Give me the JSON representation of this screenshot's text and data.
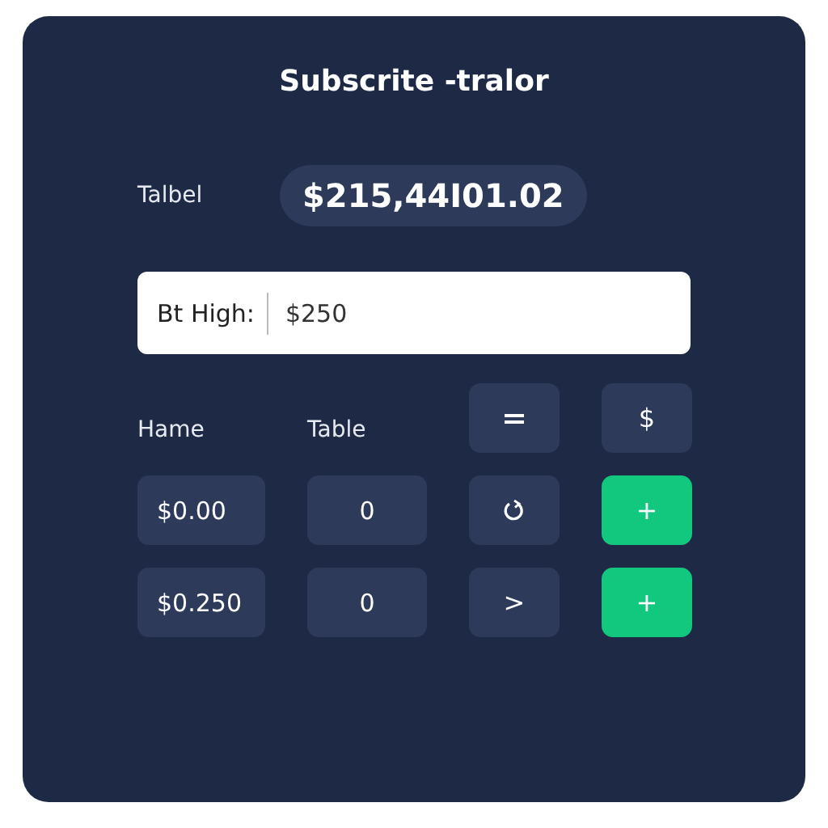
{
  "title": "Subscrite -tralor",
  "total": {
    "label": "Talbel",
    "value": "$215,44I01.02"
  },
  "field": {
    "label": "Bt High:",
    "value": "$250"
  },
  "headers": [
    "Hame",
    "Table"
  ],
  "header_buttons": [
    {
      "kind": "icon"
    },
    {
      "kind": "text",
      "label": "$"
    }
  ],
  "rows": [
    {
      "amount": "$0.00",
      "quantity": "0",
      "action": {
        "kind": "icon"
      },
      "add": "+"
    },
    {
      "amount": "$0.250",
      "quantity": "0",
      "action": {
        "kind": "text",
        "label": ">"
      },
      "add": "+"
    }
  ]
}
